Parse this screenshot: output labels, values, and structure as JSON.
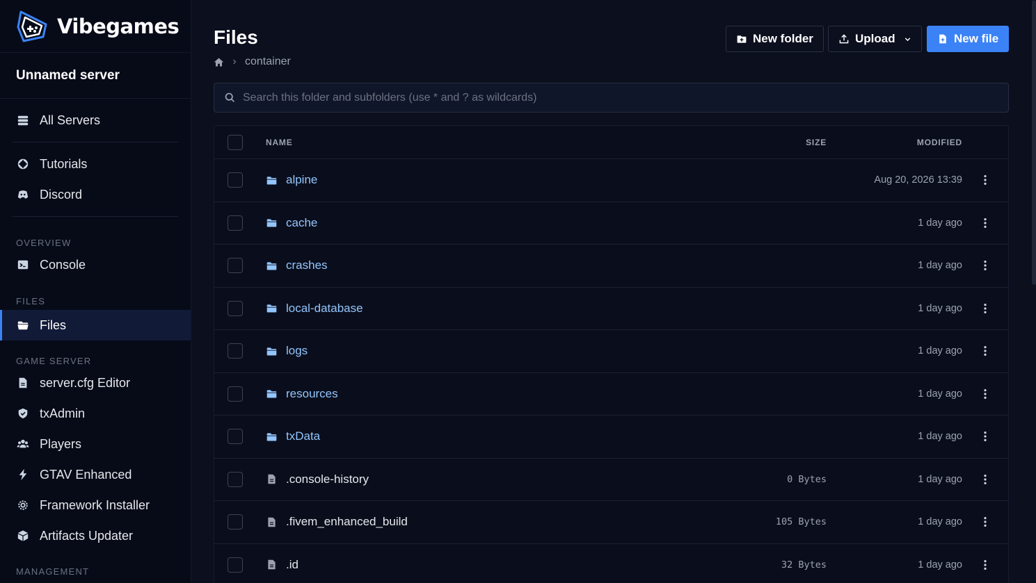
{
  "brand": {
    "name": "Vibegames"
  },
  "server": {
    "name": "Unnamed server"
  },
  "sidebar": {
    "top_items": [
      {
        "label": "All Servers",
        "icon": "server-stack-icon"
      }
    ],
    "support_items": [
      {
        "label": "Tutorials",
        "icon": "life-ring-icon"
      },
      {
        "label": "Discord",
        "icon": "discord-icon"
      }
    ],
    "sections": {
      "overview": "OVERVIEW",
      "files": "FILES",
      "game_server": "GAME SERVER",
      "management": "MANAGEMENT"
    },
    "overview_items": [
      {
        "label": "Console",
        "icon": "terminal-icon"
      }
    ],
    "files_items": [
      {
        "label": "Files",
        "icon": "folder-open-icon",
        "active": true
      }
    ],
    "game_items": [
      {
        "label": "server.cfg Editor",
        "icon": "file-icon"
      },
      {
        "label": "txAdmin",
        "icon": "shield-icon"
      },
      {
        "label": "Players",
        "icon": "users-icon"
      },
      {
        "label": "GTAV Enhanced",
        "icon": "bolt-icon"
      },
      {
        "label": "Framework Installer",
        "icon": "cog-icon"
      },
      {
        "label": "Artifacts Updater",
        "icon": "cube-icon"
      }
    ]
  },
  "page": {
    "title": "Files",
    "breadcrumb": [
      "container"
    ]
  },
  "toolbar": {
    "new_folder": "New folder",
    "upload": "Upload",
    "new_file": "New file"
  },
  "search": {
    "placeholder": "Search this folder and subfolders (use * and ? as wildcards)"
  },
  "table": {
    "headers": {
      "name": "NAME",
      "size": "SIZE",
      "modified": "MODIFIED"
    },
    "rows": [
      {
        "type": "folder",
        "name": "alpine",
        "size": "",
        "modified": "Aug 20, 2026 13:39"
      },
      {
        "type": "folder",
        "name": "cache",
        "size": "",
        "modified": "1 day ago"
      },
      {
        "type": "folder",
        "name": "crashes",
        "size": "",
        "modified": "1 day ago"
      },
      {
        "type": "folder",
        "name": "local-database",
        "size": "",
        "modified": "1 day ago"
      },
      {
        "type": "folder",
        "name": "logs",
        "size": "",
        "modified": "1 day ago"
      },
      {
        "type": "folder",
        "name": "resources",
        "size": "",
        "modified": "1 day ago"
      },
      {
        "type": "folder",
        "name": "txData",
        "size": "",
        "modified": "1 day ago"
      },
      {
        "type": "file",
        "name": ".console-history",
        "size": "0 Bytes",
        "modified": "1 day ago"
      },
      {
        "type": "file",
        "name": ".fivem_enhanced_build",
        "size": "105 Bytes",
        "modified": "1 day ago"
      },
      {
        "type": "file",
        "name": ".id",
        "size": "32 Bytes",
        "modified": "1 day ago"
      }
    ]
  },
  "colors": {
    "accent": "#3b82f6",
    "folder": "#93c5fd",
    "background": "#0b0f1e",
    "sidebar": "#070b18"
  }
}
